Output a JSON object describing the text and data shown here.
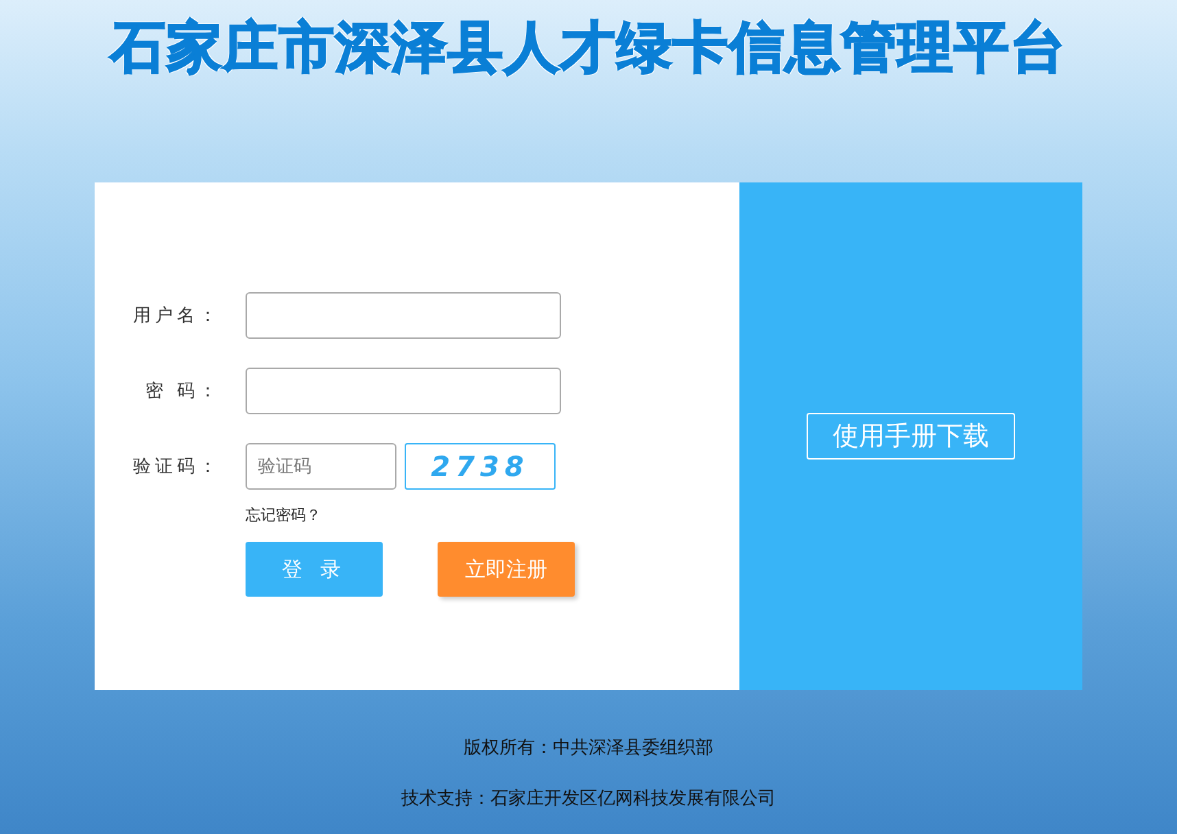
{
  "title": "石家庄市深泽县人才绿卡信息管理平台",
  "form": {
    "fields": [
      {
        "label": "用户名：",
        "kind": "text"
      },
      {
        "label": "密 码：",
        "kind": "password"
      },
      {
        "label": "验证码：",
        "kind": "captcha",
        "placeholder": "验证码",
        "captcha": "2738"
      }
    ],
    "forgot_link": "忘记密码？",
    "buttons": [
      {
        "label": "登 录",
        "kind": "primary"
      },
      {
        "label": "立即注册",
        "kind": "secondary"
      }
    ]
  },
  "manual_button": "使用手册下载",
  "footer": [
    "版权所有：中共深泽县委组织部",
    "技术支持：石家庄开发区亿网科技发展有限公司"
  ]
}
